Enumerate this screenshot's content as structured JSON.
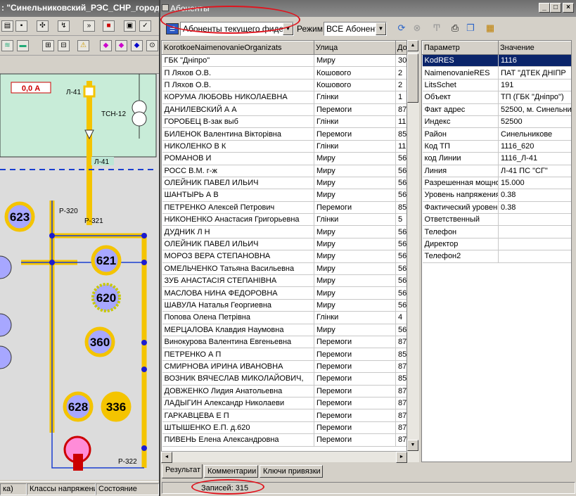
{
  "background_app": {
    "title": ": \"Синельниковский_РЭС_СНР_город\"",
    "meter_value": "0,0 А",
    "labels": [
      "Л-41",
      "ТСН-12",
      "Л-41",
      "Р-320",
      "Р-321",
      "Р-322"
    ],
    "nodes": [
      "623",
      "621",
      "620",
      "360",
      "628",
      "336"
    ],
    "status": [
      "ка)",
      "Классы напряжени",
      "Состояние"
    ]
  },
  "window": {
    "title": "Абоненты",
    "scope_combo": "Абоненты текущего фидера",
    "mode_label": "Режим:",
    "mode_combo": "ВСЕ Абоненть",
    "colors": {
      "selection": "#0a246a",
      "highlight": "#e0141e"
    }
  },
  "grid": {
    "columns": [
      "KorotkoeNaimenovanieOrganizats",
      "Улица",
      "До"
    ],
    "rows": [
      [
        "ГБК \"Дніпро\"",
        "Миру",
        "30"
      ],
      [
        "П Ляхов О.В.",
        "Кошового",
        "2"
      ],
      [
        "П Ляхов О.В.",
        "Кошового",
        "2"
      ],
      [
        "КОРУМА ЛЮБОВЬ НИКОЛАЕВНА",
        "Глінки",
        "1"
      ],
      [
        "ДАНИЛЕВСКИЙ А А",
        "Перемоги",
        "87"
      ],
      [
        "ГОРОБЕЦ В-зак выб",
        "Глінки",
        "11"
      ],
      [
        "БИЛЕНОК Валентина Вікторівна",
        "Перемоги",
        "85"
      ],
      [
        "НИКОЛЕНКО В К",
        "Глінки",
        "11"
      ],
      [
        "РОМАНОВ И",
        "Миру",
        "56"
      ],
      [
        "РОСС В.М. г-ж",
        "Миру",
        "56"
      ],
      [
        "ОЛЕЙНИК ПАВЕЛ ИЛЬИЧ",
        "Миру",
        "56/"
      ],
      [
        "ШАНТЫРЬ А В",
        "Миру",
        "56"
      ],
      [
        "ПЕТРЕНКО Алексей Петрович",
        "Перемоги",
        "85"
      ],
      [
        "НИКОНЕНКО Анастасия Григорьевна",
        "Глінки",
        "5"
      ],
      [
        "ДУДНИК Л Н",
        "Миру",
        "56"
      ],
      [
        "ОЛЕЙНИК ПАВЕЛ ИЛЬИЧ",
        "Миру",
        "56"
      ],
      [
        "МОРОЗ ВЕРА СТЕПАНОВНА",
        "Миру",
        "56"
      ],
      [
        "ОМЕЛЬЧЕНКО Татьяна Васильевна",
        "Миру",
        "56"
      ],
      [
        "ЗУБ АНАСТАСІЯ СТЕПАНІВНА",
        "Миру",
        "56"
      ],
      [
        "МАСЛОВА НИНА ФЕДОРОВНА",
        "Миру",
        "56"
      ],
      [
        "ШАВУЛА Наталья Георгиевна",
        "Миру",
        "56"
      ],
      [
        "Попова Олена Петрівна",
        "Глінки",
        "4"
      ],
      [
        "МЕРЦАЛОВА Клавдия Наумовна",
        "Миру",
        "56"
      ],
      [
        "Винокурова Валентина Евгеньевна",
        "Перемоги",
        "87"
      ],
      [
        "ПЕТРЕНКО А П",
        "Перемоги",
        "85/"
      ],
      [
        "СМИРНОВА ИРИНА ИВАНОВНА",
        "Перемоги",
        "87"
      ],
      [
        "ВОЗНИК ВЯЧЕСЛАВ МИКОЛАЙОВИЧ,",
        "Перемоги",
        "85/"
      ],
      [
        "ДОВЖЕНКО Лидия Анатольевна",
        "Перемоги",
        "87"
      ],
      [
        "ЛАДЫГИН Александр Николаеви",
        "Перемоги",
        "87"
      ],
      [
        "ГАРКАВЦЕВА Е П",
        "Перемоги",
        "87"
      ],
      [
        "ШТЫШЕНКО Е.П. д.620",
        "Перемоги",
        "87"
      ],
      [
        "ПИВЕНЬ Елена Александровна",
        "Перемоги",
        "87"
      ]
    ]
  },
  "params": {
    "columns": [
      "Параметр",
      "Значение"
    ],
    "rows": [
      [
        "KodRES",
        "1116"
      ],
      [
        "NaimenovanieRES",
        "ПАТ \"ДТЕК ДНІПР"
      ],
      [
        "LitsSchet",
        "191"
      ],
      [
        "Объект",
        "ТП (ГБК \"Дніпро\")"
      ],
      [
        "Факт адрес",
        "52500, м. Синельни"
      ],
      [
        "Индекс",
        "52500"
      ],
      [
        "Район",
        "Синельникове"
      ],
      [
        "Код ТП",
        "1116_620"
      ],
      [
        "код Линии",
        "1116_Л-41"
      ],
      [
        "Линия",
        "Л-41 ПС \"СГ\""
      ],
      [
        "Разрешенная мощнос",
        "15.000"
      ],
      [
        "Уровень напряжения",
        "0.38"
      ],
      [
        "Фактический уровень",
        "0.38"
      ],
      [
        "Ответственный",
        ""
      ],
      [
        "Телефон",
        ""
      ],
      [
        "Директор",
        ""
      ],
      [
        "Телефон2",
        ""
      ]
    ]
  },
  "tabs": [
    "Результат",
    "Комментарии",
    "Ключи привязки"
  ],
  "status": {
    "records": "Записей: 315"
  }
}
